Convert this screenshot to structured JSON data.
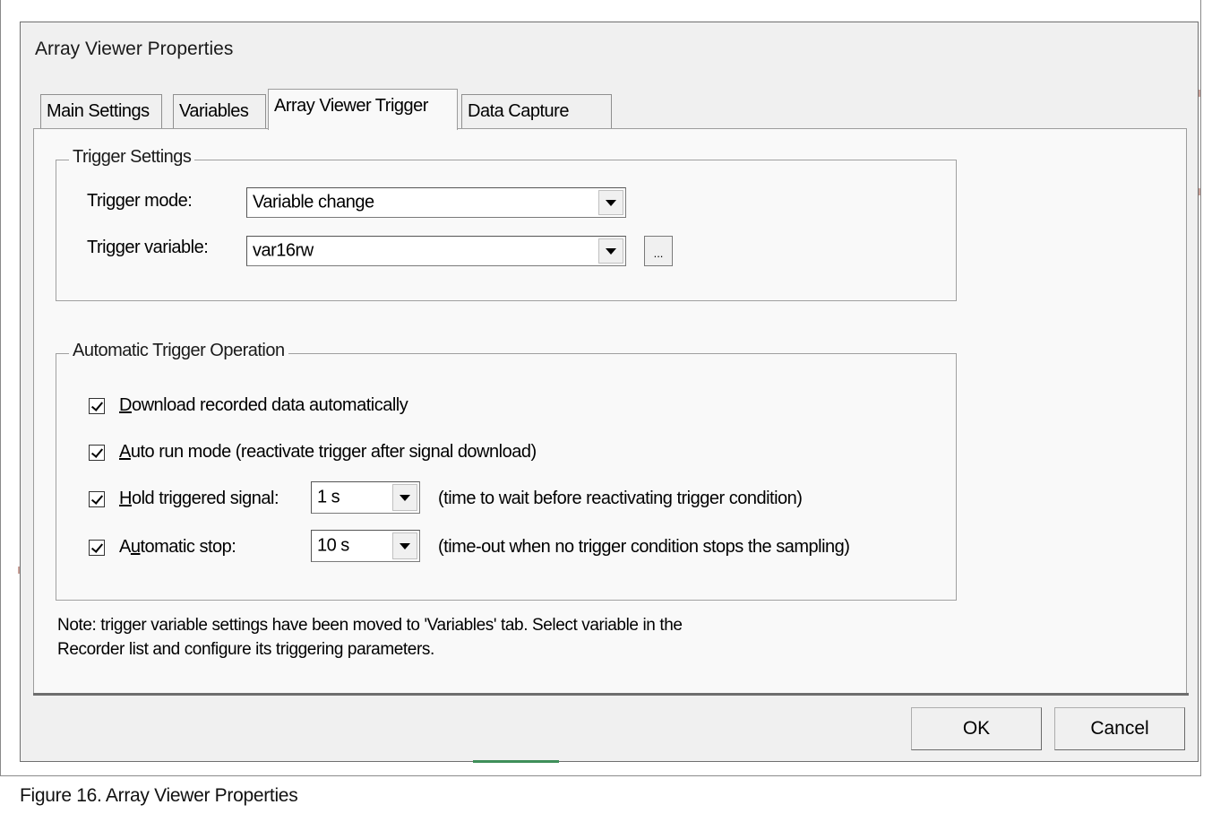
{
  "dialog": {
    "title": "Array Viewer Properties",
    "tabs": [
      {
        "label": "Main Settings",
        "active": false
      },
      {
        "label": "Variables",
        "active": false
      },
      {
        "label": "Array Viewer Trigger",
        "active": true
      },
      {
        "label": "Data Capture",
        "active": false
      }
    ]
  },
  "trigger_settings": {
    "group_label": "Trigger Settings",
    "mode_label": "Trigger mode:",
    "mode_value": "Variable change",
    "variable_label": "Trigger variable:",
    "variable_value": "var16rw",
    "browse_label": "..."
  },
  "automatic": {
    "group_label": "Automatic Trigger Operation",
    "download": {
      "mnemonic": "D",
      "rest": "ownload recorded data automatically",
      "checked": true
    },
    "auto_run": {
      "mnemonic": "A",
      "rest": "uto run mode (reactivate trigger after signal download)",
      "checked": true
    },
    "hold": {
      "mnemonic": "H",
      "rest": "old triggered signal:",
      "value": "1 s",
      "hint": "(time to wait before reactivating trigger condition)",
      "checked": true
    },
    "stop": {
      "before": "A",
      "mnemonic": "u",
      "rest": "tomatic stop:",
      "value": "10 s",
      "hint": "(time-out when no trigger condition stops the sampling)",
      "checked": true
    }
  },
  "note": {
    "line1": "Note: trigger variable settings have been moved to 'Variables' tab. Select variable in the",
    "line2": "Recorder list and configure its triggering parameters."
  },
  "buttons": {
    "ok": "OK",
    "cancel": "Cancel"
  },
  "caption": "Figure 16.  Array Viewer Properties"
}
